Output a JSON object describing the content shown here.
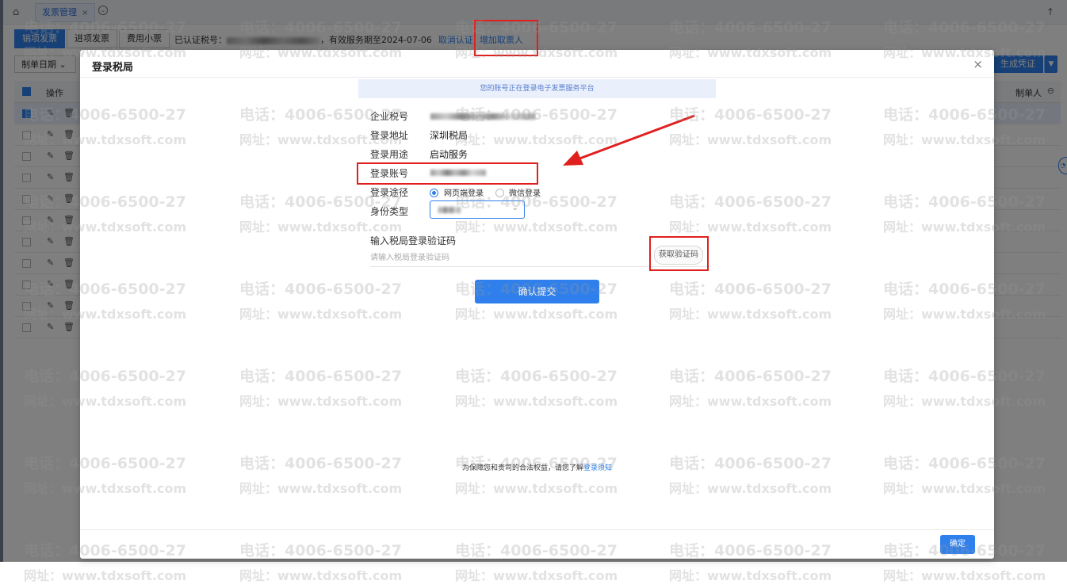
{
  "app": {
    "tab_label": "发票管理",
    "tab_close": "×",
    "sub_tabs": [
      "销项发票",
      "进项发票",
      "费用小票"
    ],
    "cert_prefix": "已认证税号：",
    "cert_suffix": "，有效服务期至2024-07-06",
    "cancel_cert": "取消认证",
    "add_drawer": "增加取票人",
    "date_filter": "制单日期",
    "generate_btn": "生成凭证",
    "col_operation": "操作",
    "col_maker": "制单人"
  },
  "modal": {
    "title": "登录税局",
    "close": "×",
    "notice": "您的账号正在登录电子发票服务平台",
    "fields": {
      "tax_id_label": "企业税号",
      "address_label": "登录地址",
      "address_value": "深圳税局",
      "purpose_label": "登录用途",
      "purpose_value": "启动服务",
      "account_label": "登录账号",
      "method_label": "登录途径",
      "method_web": "网页端登录",
      "method_wechat": "微信登录",
      "identity_label": "身份类型"
    },
    "code_label": "输入税局登录验证码",
    "code_placeholder": "请输入税局登录验证码",
    "get_code": "获取验证码",
    "submit": "确认提交",
    "footer_prefix": "为保障您和贵司的合法权益，请您了解",
    "footer_link": "登录须知",
    "ok": "确定"
  },
  "watermark": {
    "phone": "电话：4006-6500-27",
    "site": "网址：www.tdxsoft.com"
  },
  "colors": {
    "primary": "#2f80ed",
    "annotation_red": "#e0201e"
  }
}
